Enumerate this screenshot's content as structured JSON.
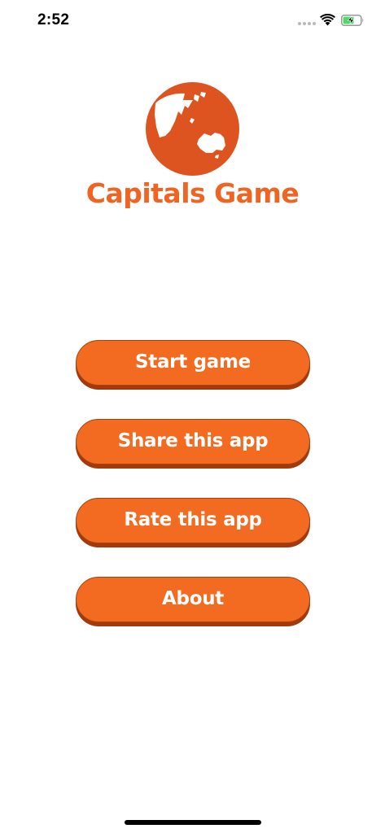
{
  "status_bar": {
    "time": "2:52"
  },
  "app": {
    "title": "Capitals Game",
    "logo_icon": "globe-icon",
    "accent_color": "#f26b21",
    "shadow_color": "#a23a0c"
  },
  "menu": {
    "start_label": "Start game",
    "share_label": "Share this app",
    "rate_label": "Rate this app",
    "about_label": "About"
  }
}
